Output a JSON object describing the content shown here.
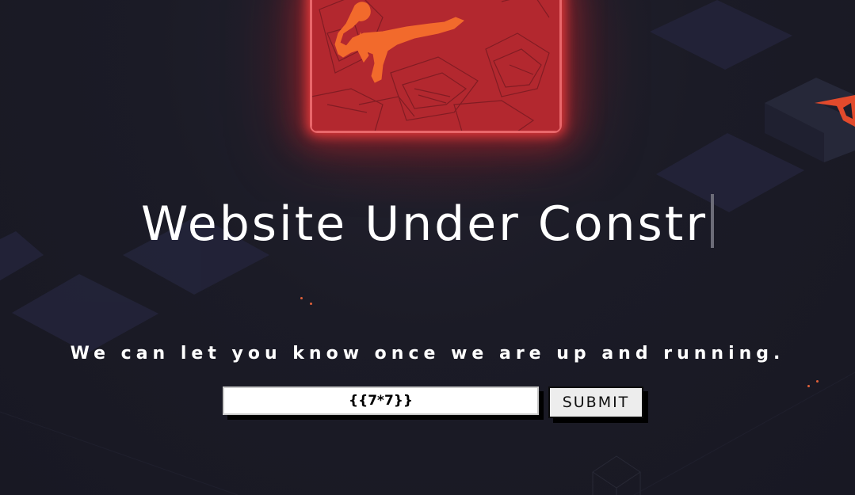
{
  "page": {
    "title": "Website Under Constr",
    "subtitle": "We can let you know once we are up and running."
  },
  "form": {
    "email_value": "{{7*7}}",
    "submit_label": "SUBMIT"
  },
  "colors": {
    "background": "#1a1a25",
    "accent": "#e74a3b",
    "hero_red": "#b0272f",
    "text": "#ffffff"
  },
  "icons": {
    "hero": "fighter-illustration",
    "logo": "brand-triangle-logo"
  }
}
